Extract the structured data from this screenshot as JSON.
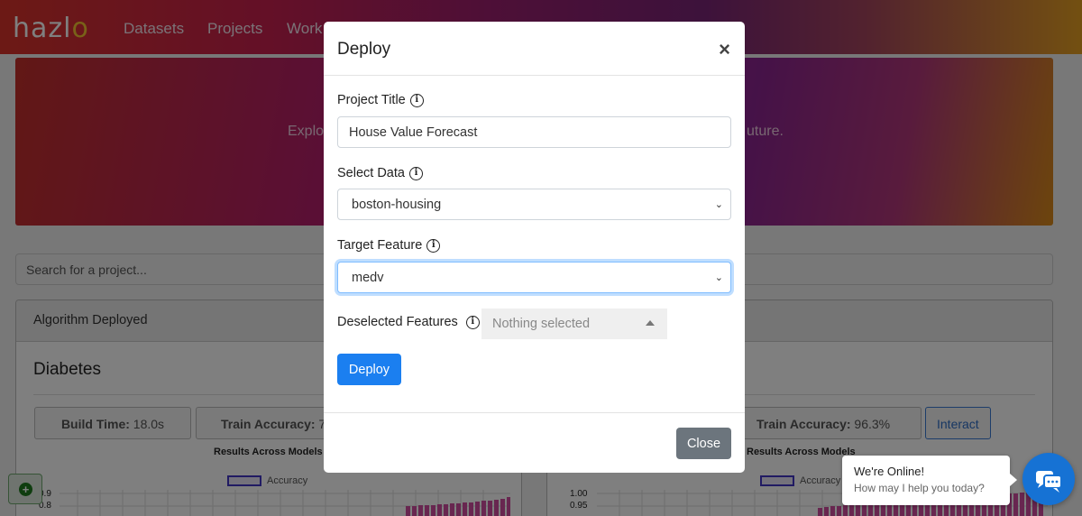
{
  "app": {
    "logo_text": "hazl",
    "logo_accent": "o",
    "nav": [
      "Datasets",
      "Projects",
      "Work"
    ]
  },
  "hero": {
    "text_left": "Explo",
    "text_right": "uture."
  },
  "search": {
    "placeholder": "Search for a project..."
  },
  "cards": [
    {
      "header": "Algorithm Deployed",
      "title": "Diabetes",
      "build_time_label": "Build Time:",
      "build_time_value": "18.0s",
      "train_acc_label": "Train Accuracy:",
      "train_acc_value": "7",
      "chart_title": "Results Across Models",
      "legend": "Accuracy",
      "yticks": [
        "0.9",
        "0.8"
      ]
    },
    {
      "train_acc_label": "Train Accuracy:",
      "train_acc_value": "96.3%",
      "interact_label": "Interact",
      "chart_title": "Results Across Models",
      "legend": "Accuracy",
      "yticks": [
        "1.00",
        "0.95"
      ]
    }
  ],
  "modal": {
    "title": "Deploy",
    "close_symbol": "×",
    "project_title_label": "Project Title",
    "project_title_value": "House Value Forecast",
    "select_data_label": "Select Data",
    "select_data_value": "boston-housing",
    "target_feature_label": "Target Feature",
    "target_feature_value": "medv",
    "deselected_label": "Deselected Features",
    "deselected_placeholder": "Nothing selected",
    "deploy_label": "Deploy",
    "close_label": "Close",
    "info_icon_glyph": "i"
  },
  "chat": {
    "line1": "We're Online!",
    "line2": "How may I help you today?"
  },
  "colors": {
    "primary": "#1b7ff0",
    "secondary": "#6c757d",
    "chart_bar": "#d14da0",
    "legend_stroke": "#4336c7"
  }
}
